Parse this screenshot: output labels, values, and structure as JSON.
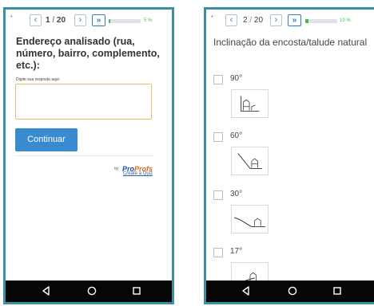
{
  "colors": {
    "frame_border": "#3d8fa3",
    "accent_blue": "#3579c9",
    "button_blue": "#3a8ad0",
    "progress_green": "#3fbf3f",
    "input_border": "#e8bf6a",
    "android_bar": "#060606"
  },
  "screen1": {
    "nav": {
      "prev_icon": "chevron-left-icon",
      "current": "1",
      "separator": "/",
      "total": "20",
      "next_icon": "chevron-right-icon",
      "skip_icon": "double-chevron-right-icon",
      "progress_text": "5 %",
      "progress_fraction": 0.05
    },
    "question": "Endereço analisado (rua, número, bairro, complemento, etc.):",
    "answer_label": "Digite sua resposta aqui:",
    "answer_value": "",
    "continue_label": "Continuar",
    "branding": {
      "by": "by",
      "brand_part1": "Pro",
      "brand_part2": "Profs",
      "create_link": "Create a Quiz"
    }
  },
  "screen2": {
    "nav": {
      "prev_icon": "chevron-left-icon",
      "current": "2",
      "separator": "/",
      "total": "20",
      "next_icon": "chevron-right-icon",
      "skip_icon": "double-chevron-right-icon",
      "progress_text": "10 %",
      "progress_fraction": 0.1
    },
    "question": "Inclinação da encosta/talude natural",
    "options": [
      {
        "label": "90°",
        "checked": false,
        "image_icon": "vertical-slope-house-icon"
      },
      {
        "label": "60°",
        "checked": false,
        "image_icon": "steep-slope-house-icon"
      },
      {
        "label": "30°",
        "checked": false,
        "image_icon": "moderate-slope-house-icon"
      },
      {
        "label": "17°",
        "checked": false,
        "image_icon": "gentle-slope-house-icon"
      }
    ]
  },
  "android_nav": {
    "back_icon": "back-triangle-icon",
    "home_icon": "home-circle-icon",
    "recents_icon": "recents-square-icon"
  }
}
